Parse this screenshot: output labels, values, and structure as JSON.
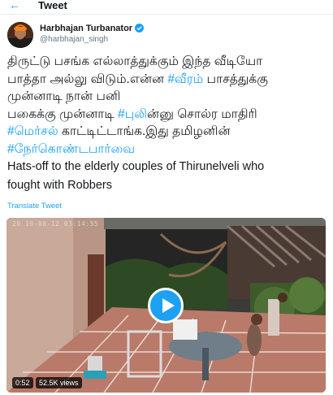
{
  "header": {
    "back_icon": "arrow-left-icon",
    "title": "Tweet"
  },
  "author": {
    "display_name": "Harbhajan Turbanator",
    "handle": "@harbhajan_singh",
    "verified_icon": "verified-badge-icon"
  },
  "tweet": {
    "lines": [
      [
        {
          "text": "திருட்டு பசங்க எல்லாத்துக்கும் இந்த வீடியோ"
        }
      ],
      [
        {
          "text": "பாத்தா அல்லு விடும்.என்ன "
        },
        {
          "text": "#வீரம்",
          "hashtag": true
        },
        {
          "text": " பாசத்துக்கு"
        }
      ],
      [
        {
          "text": "முன்னாடி நான் பனி"
        }
      ],
      [
        {
          "text": "பகைக்கு முன்னாடி "
        },
        {
          "text": "#புலி",
          "hashtag": true
        },
        {
          "text": "ன்னு சொல்ர மாதிரி"
        }
      ],
      [
        {
          "text": "#மெர்சல்",
          "hashtag": true
        },
        {
          "text": " காட்டிட்டாங்க.இது தமிழனின்"
        }
      ],
      [
        {
          "text": "#நேர்கொண்டபார்வை",
          "hashtag": true
        }
      ],
      [
        {
          "text": "Hats-off to the elderly couples of Thirunelveli who",
          "eng": true
        }
      ],
      [
        {
          "text": "fought with  Robbers",
          "eng": true
        }
      ]
    ]
  },
  "translate_label": "Translate Tweet",
  "video": {
    "timestamp_overlay": "20 19-08-12  03:14:55",
    "duration": "0:52",
    "views": "52.5K views",
    "play_icon": "play-icon"
  },
  "colors": {
    "accent": "#1da1f2",
    "text": "#14171a",
    "muted": "#657786"
  }
}
